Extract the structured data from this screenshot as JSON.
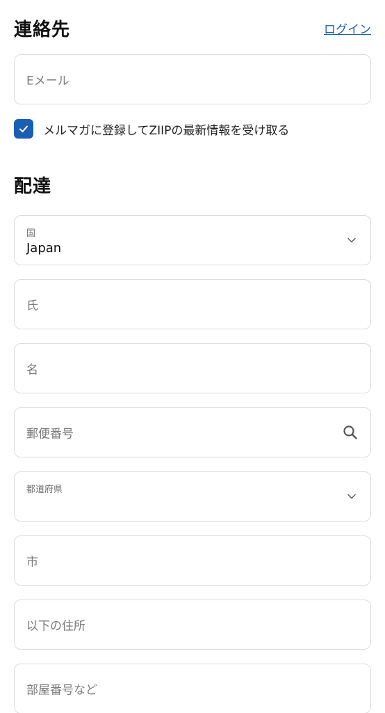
{
  "contact": {
    "title": "連絡先",
    "login_label": "ログイン",
    "email_placeholder": "Eメール",
    "newsletter_label": "メルマガに登録してZIIPの最新情報を受け取る",
    "newsletter_checked": true
  },
  "delivery": {
    "title": "配達",
    "country_label": "国",
    "country_value": "Japan",
    "last_name_placeholder": "氏",
    "first_name_placeholder": "名",
    "postal_placeholder": "郵便番号",
    "prefecture_label": "都道府県",
    "city_placeholder": "市",
    "address_placeholder": "以下の住所",
    "apartment_placeholder": "部屋番号など"
  },
  "icons": {
    "check": "check-icon",
    "chevron": "chevron-down-icon",
    "search": "search-icon"
  },
  "colors": {
    "accent": "#1a5fb4",
    "border": "#dcdcdc",
    "placeholder": "#7a7a7a"
  }
}
